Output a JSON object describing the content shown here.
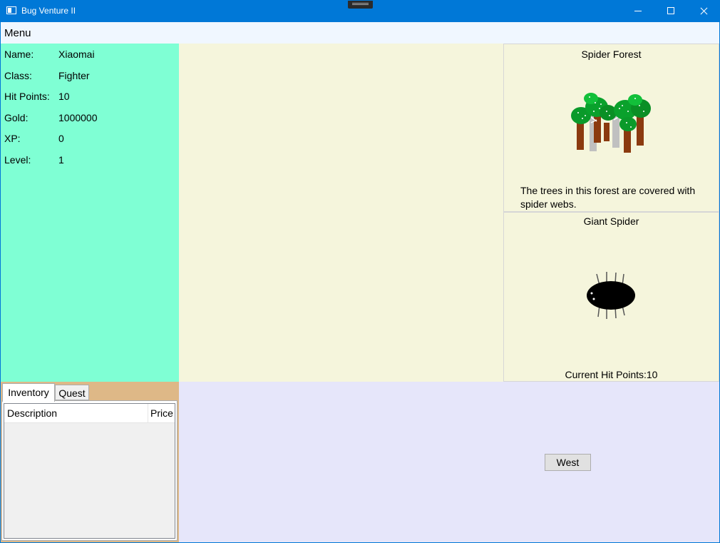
{
  "window": {
    "title": "Bug Venture II",
    "icon": "app-window-icon",
    "controls": [
      "minimize-icon",
      "maximize-icon",
      "close-icon"
    ],
    "accent_color": "#0078d7"
  },
  "menu": {
    "label": "Menu"
  },
  "player": {
    "stats": [
      {
        "label": "Name:",
        "value": "Xiaomai"
      },
      {
        "label": "Class:",
        "value": "Fighter"
      },
      {
        "label": "Hit Points:",
        "value": "10"
      },
      {
        "label": "Gold:",
        "value": "1000000"
      },
      {
        "label": "XP:",
        "value": "0"
      },
      {
        "label": "Level:",
        "value": "1"
      }
    ],
    "background_color": "#7fffd4"
  },
  "location": {
    "name": "Spider Forest",
    "image": "forest-trees-image",
    "description": "The trees in this forest are covered with spider webs."
  },
  "monster": {
    "name": "Giant Spider",
    "image": "giant-spider-image",
    "hit_points": "Current Hit Points:10"
  },
  "tabs": [
    {
      "label": "Inventory",
      "selected": true
    },
    {
      "label": "Quest",
      "selected": false
    }
  ],
  "inventory": {
    "columns": [
      "Description",
      "Price"
    ],
    "rows": []
  },
  "movement": {
    "west_label": "West",
    "background_color": "#e6e6fa"
  },
  "colors": {
    "panel_beige": "#f5f5dc",
    "tab_strip": "#deb887"
  }
}
